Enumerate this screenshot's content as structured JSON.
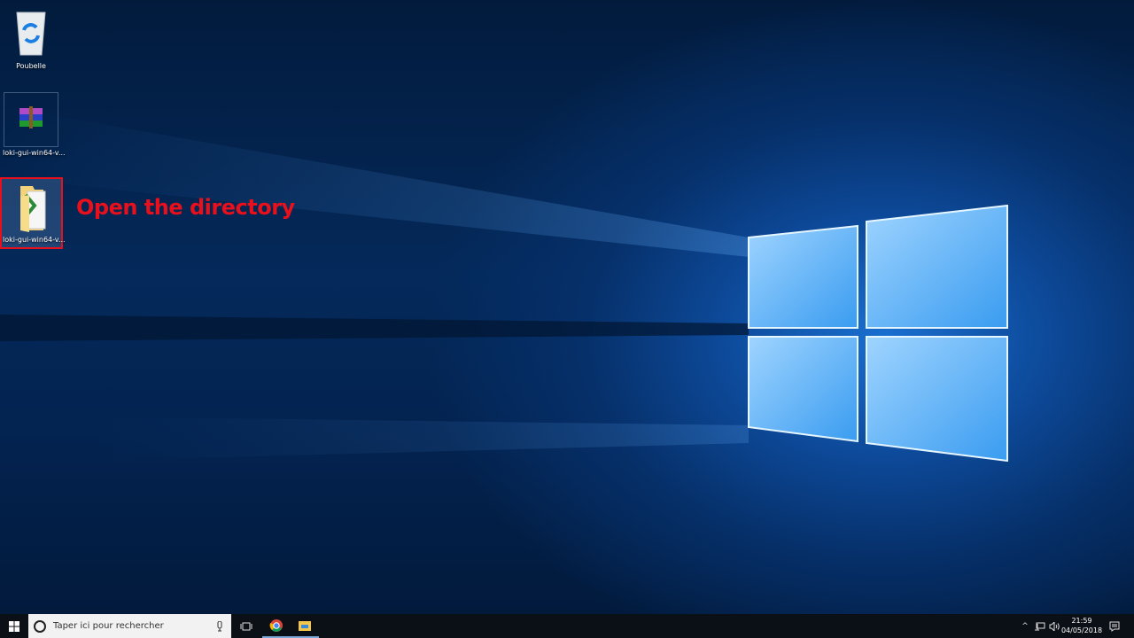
{
  "desktop": {
    "icons": [
      {
        "label": "Poubelle",
        "icon": "recycle-bin-icon"
      },
      {
        "label": "loki-gui-win64-v...",
        "icon": "winrar-archive-icon"
      },
      {
        "label": "loki-gui-win64-v...",
        "icon": "folder-icon"
      }
    ],
    "annotation": "Open the directory",
    "annotation_color": "#e8101c"
  },
  "taskbar": {
    "search_placeholder": "Taper ici pour rechercher",
    "clock_time": "21:59",
    "clock_date": "04/05/2018"
  }
}
